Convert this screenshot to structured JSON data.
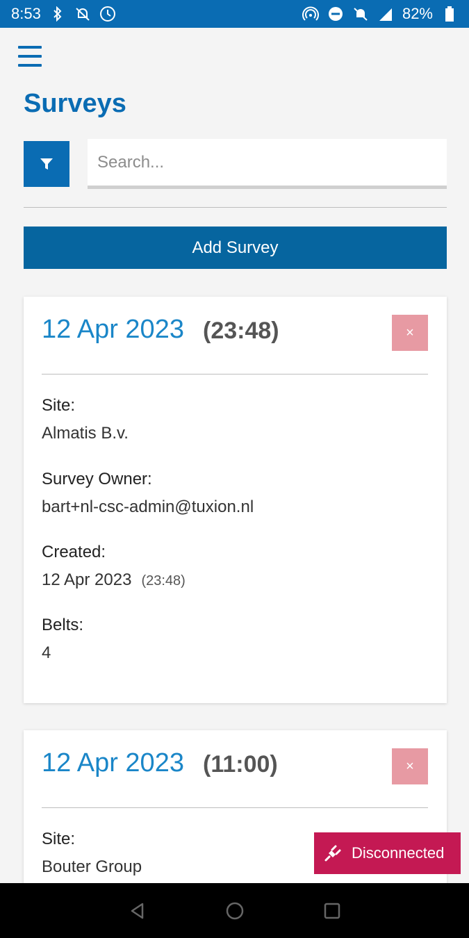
{
  "status_bar": {
    "time": "8:53",
    "battery": "82%",
    "icons_left": [
      "bluetooth-icon",
      "notifications-off-icon",
      "alarm-icon"
    ],
    "icons_right": [
      "hotspot-icon",
      "do-not-disturb-icon",
      "mute-icon",
      "signal-icon",
      "battery-icon"
    ]
  },
  "header": {
    "menu_icon": "hamburger-menu-icon",
    "title": "Surveys"
  },
  "search": {
    "placeholder": "Search...",
    "value": "",
    "filter_icon": "filter-icon"
  },
  "actions": {
    "add_label": "Add Survey"
  },
  "surveys": [
    {
      "date": "12 Apr 2023",
      "time": "(23:48)",
      "delete_label": "×",
      "site_label": "Site:",
      "site": "Almatis B.v.",
      "owner_label": "Survey Owner:",
      "owner": "bart+nl-csc-admin@tuxion.nl",
      "created_label": "Created:",
      "created_date": "12 Apr 2023",
      "created_time": "(23:48)",
      "belts_label": "Belts:",
      "belts": "4"
    },
    {
      "date": "12 Apr 2023",
      "time": "(11:00)",
      "delete_label": "×",
      "site_label": "Site:",
      "site": "Bouter Group"
    }
  ],
  "toast": {
    "label": "Disconnected",
    "icon": "plug-icon"
  },
  "nav": {
    "back_icon": "back-icon",
    "home_icon": "home-icon",
    "recents_icon": "recents-icon"
  },
  "colors": {
    "primary": "#0a6cb3",
    "button": "#06659f",
    "date": "#1a86c8",
    "delete": "#e79aa3",
    "toast": "#c41953"
  }
}
